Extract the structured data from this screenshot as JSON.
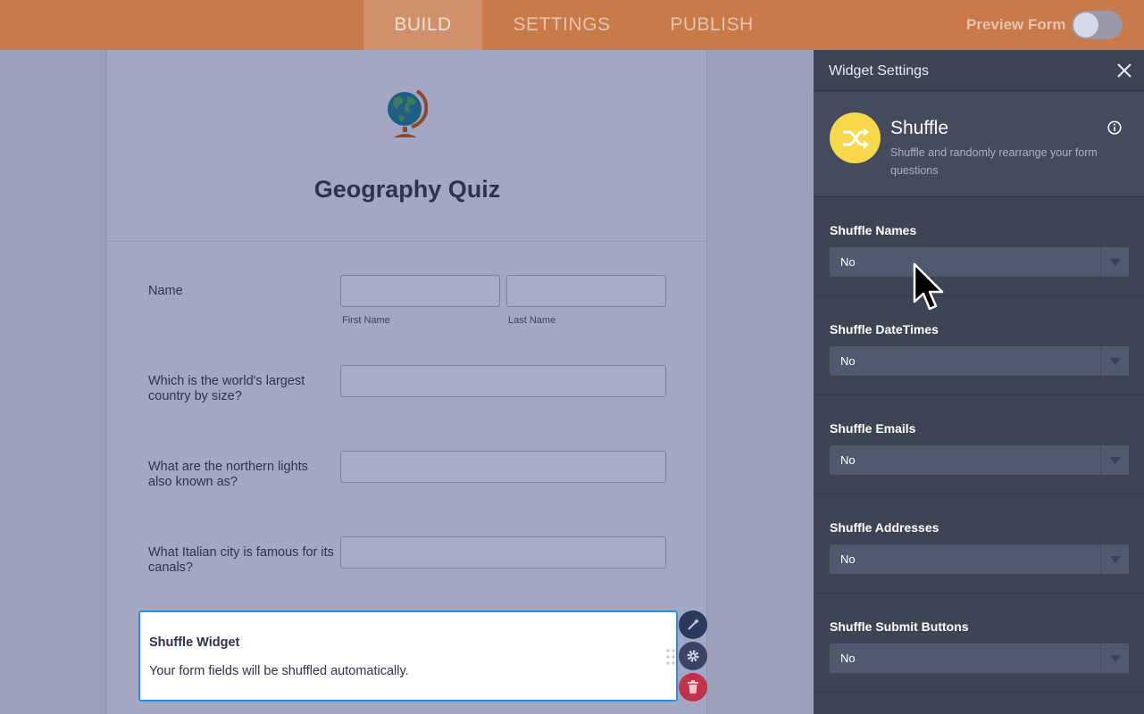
{
  "topbar": {
    "tabs": [
      {
        "label": "BUILD",
        "active": true
      },
      {
        "label": "SETTINGS",
        "active": false
      },
      {
        "label": "PUBLISH",
        "active": false
      }
    ],
    "preview_label": "Preview Form",
    "preview_enabled": false
  },
  "form": {
    "title": "Geography Quiz",
    "name_field": {
      "label": "Name",
      "first_sublabel": "First Name",
      "last_sublabel": "Last Name"
    },
    "questions": [
      {
        "label": "Which is the world's largest country by size?"
      },
      {
        "label": "What are the northern lights also known as?"
      },
      {
        "label": "What Italian city is famous for its canals?"
      }
    ],
    "shuffle_widget": {
      "title": "Shuffle Widget",
      "text": "Your form fields will be shuffled automatically."
    }
  },
  "panel": {
    "title": "Widget Settings",
    "widget_name": "Shuffle",
    "widget_description": "Shuffle and randomly rearrange your form questions",
    "settings": [
      {
        "label": "Shuffle Names",
        "value": "No"
      },
      {
        "label": "Shuffle DateTimes",
        "value": "No"
      },
      {
        "label": "Shuffle Emails",
        "value": "No"
      },
      {
        "label": "Shuffle Addresses",
        "value": "No"
      },
      {
        "label": "Shuffle Submit Buttons",
        "value": "No"
      }
    ]
  },
  "colors": {
    "topbar": "#c87a48",
    "panel": "#3d4555",
    "widget_border": "#2f8fd6",
    "shuffle_logo": "#f6d84a",
    "delete_button": "#c0334a"
  },
  "icons": [
    "globe-icon",
    "shuffle-icon",
    "info-icon",
    "close-icon",
    "wand-icon",
    "gear-icon",
    "trash-icon",
    "drag-handle-icon",
    "mouse-cursor-icon"
  ]
}
